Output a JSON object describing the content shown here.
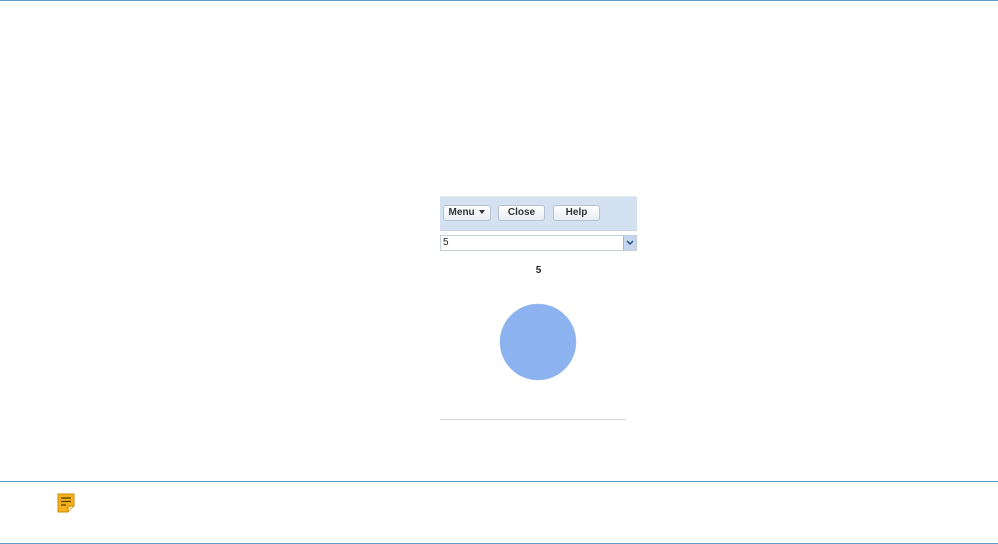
{
  "toolbar": {
    "menu_label": "Menu",
    "close_label": "Close",
    "help_label": "Help"
  },
  "selector": {
    "selected_value": "5"
  },
  "chart_data": {
    "type": "pie",
    "title": "5",
    "categories": [
      "5"
    ],
    "values": [
      1
    ],
    "colors": [
      "#8cb2f0"
    ]
  },
  "note": {
    "icon": "note-icon",
    "color": "#f6b21b"
  }
}
